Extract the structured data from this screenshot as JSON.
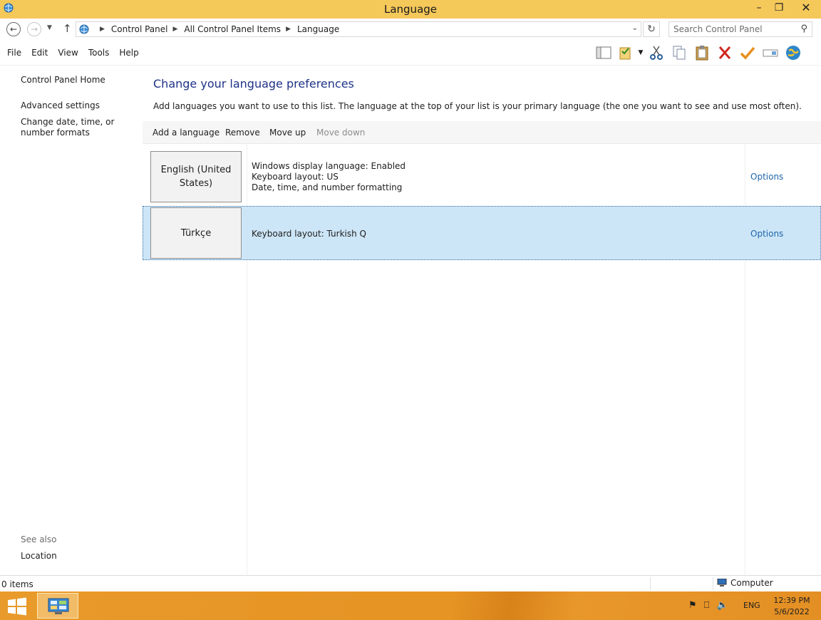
{
  "window": {
    "title": "Language",
    "minimize_glyph": "–",
    "maximize_glyph": "❐",
    "close_glyph": "✕"
  },
  "address": {
    "crumbs": [
      "Control Panel",
      "All Control Panel Items",
      "Language"
    ],
    "search_placeholder": "Search Control Panel"
  },
  "menu": [
    "File",
    "Edit",
    "View",
    "Tools",
    "Help"
  ],
  "toolbar_icons": [
    "layout-icon",
    "properties-icon",
    "cut-icon",
    "copy-icon",
    "paste-icon",
    "delete-icon",
    "check-icon",
    "rename-icon",
    "globe-icon"
  ],
  "sidebar": {
    "home": "Control Panel Home",
    "advanced": "Advanced settings",
    "datetime": "Change date, time, or number formats",
    "see_also": "See also",
    "location": "Location"
  },
  "main": {
    "heading": "Change your language preferences",
    "description": "Add languages you want to use to this list. The language at the top of your list is your primary language (the one you want to see and use most often).",
    "commands": {
      "add": "Add a language",
      "remove": "Remove",
      "move_up": "Move up",
      "move_down": "Move down"
    },
    "languages": [
      {
        "name": "English (United States)",
        "details": [
          "Windows display language: Enabled",
          "Keyboard layout: US",
          "Date, time, and number formatting"
        ],
        "options": "Options",
        "selected": false
      },
      {
        "name": "Türkçe",
        "details": [
          "Keyboard layout: Turkish Q"
        ],
        "options": "Options",
        "selected": true
      }
    ]
  },
  "status": {
    "items": "0 items",
    "zone": "Computer"
  },
  "taskbar": {
    "lang": "ENG",
    "time": "12:39 PM",
    "date": "5/6/2022"
  },
  "colors": {
    "titlebar": "#f5c85a",
    "heading": "#1e3287",
    "link": "#1e64a8",
    "selection": "#cde6f7",
    "taskbar": "#e69424"
  }
}
